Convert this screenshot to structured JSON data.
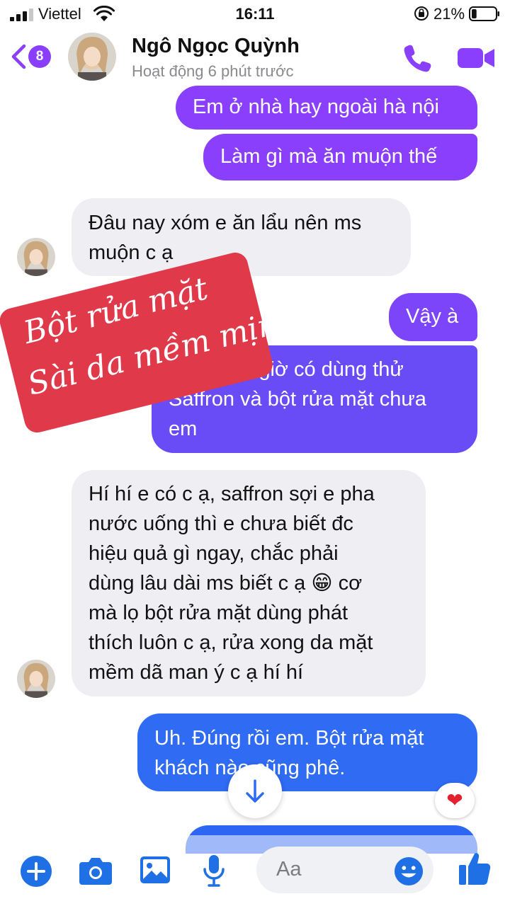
{
  "status_bar": {
    "carrier": "Viettel",
    "time": "16:11",
    "battery_percent": "21%",
    "battery_level": 0.21
  },
  "header": {
    "unread_count": "8",
    "contact_name": "Ngô Ngọc Quỳnh",
    "contact_status": "Hoạt động 6 phút trước"
  },
  "messages": [
    {
      "from": "me",
      "lines": [
        "Em ở nhà hay ngoài hà nội"
      ]
    },
    {
      "from": "me",
      "lines": [
        "Làm gì mà ăn muộn thế"
      ]
    },
    {
      "from": "them",
      "lines": [
        "Đâu nay xóm e ăn lẩu nên ms",
        "muộn c ạ"
      ]
    },
    {
      "from": "me",
      "lines": [
        "Vậy à"
      ]
    },
    {
      "from": "me",
      "lines": [
        "Mấy hôm giờ có dùng thử",
        "Saffron và bột rửa mặt chưa",
        "em"
      ]
    },
    {
      "from": "them",
      "lines": [
        "Hí hí e có c ạ, saffron sợi e pha",
        "nước uống thì e chưa biết đc",
        "hiệu quả gì ngay, chắc phải",
        "dùng lâu dài ms biết c ạ 😁 cơ",
        "mà lọ bột rửa mặt dùng phát",
        "thích luôn c ạ, rửa xong da mặt",
        "mềm dã man ý c ạ hí hí"
      ]
    },
    {
      "from": "me",
      "lines": [
        "Uh. Đúng rồi em. Bột rửa mặt",
        "khách nào cũng phê."
      ]
    }
  ],
  "promo": {
    "line1": "Bột rửa mặt",
    "line2": "Sài da mềm mịn"
  },
  "reaction": "❤",
  "composer": {
    "placeholder": "Aa"
  },
  "colors": {
    "accent": "#8a3ffc",
    "bubble_purple": "#8a3ffc",
    "bubble_indigo": "#6a4cf6",
    "bubble_blue": "#2f6bf3",
    "incoming": "#efeef3",
    "promo": "#e0394a"
  },
  "icons": [
    "back-chevron-icon",
    "phone-icon",
    "video-camera-icon",
    "plus-icon",
    "camera-icon",
    "image-icon",
    "microphone-icon",
    "emoji-icon",
    "thumbs-up-icon",
    "arrow-down-icon"
  ]
}
